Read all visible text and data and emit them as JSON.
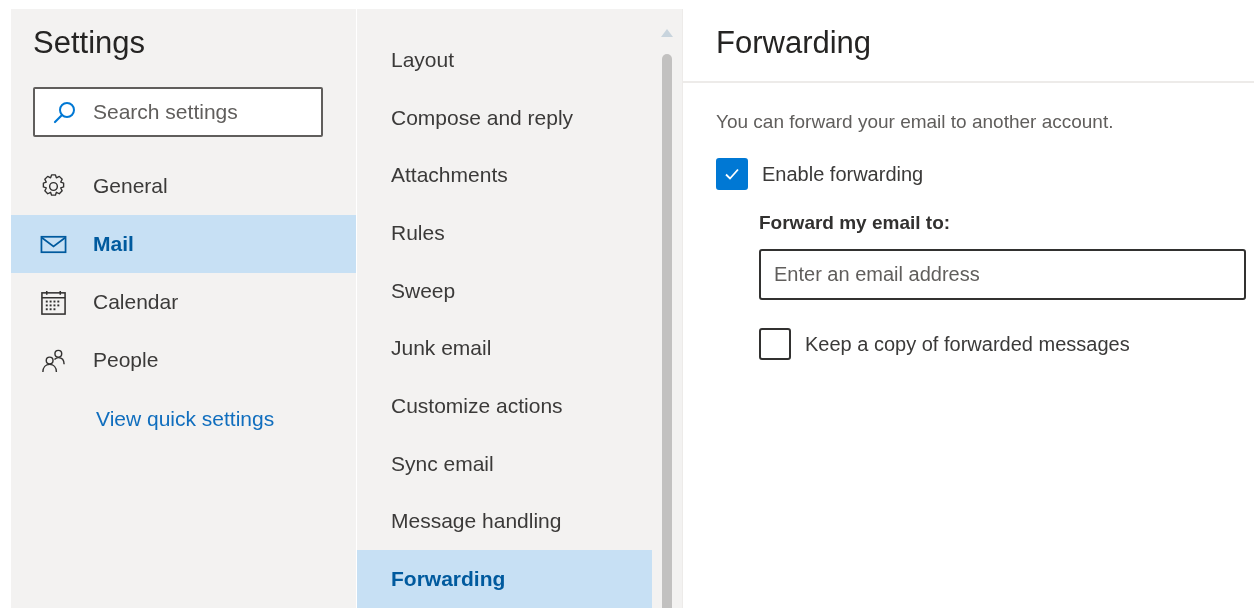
{
  "sidebar": {
    "title": "Settings",
    "search": {
      "placeholder": "Search settings"
    },
    "items": [
      {
        "label": "General",
        "kind": "gear",
        "selected": false
      },
      {
        "label": "Mail",
        "kind": "mail",
        "selected": true
      },
      {
        "label": "Calendar",
        "kind": "calendar",
        "selected": false
      },
      {
        "label": "People",
        "kind": "people",
        "selected": false
      }
    ],
    "link": "View quick settings"
  },
  "submenu": {
    "items": [
      {
        "label": "Layout",
        "selected": false
      },
      {
        "label": "Compose and reply",
        "selected": false
      },
      {
        "label": "Attachments",
        "selected": false
      },
      {
        "label": "Rules",
        "selected": false
      },
      {
        "label": "Sweep",
        "selected": false
      },
      {
        "label": "Junk email",
        "selected": false
      },
      {
        "label": "Customize actions",
        "selected": false
      },
      {
        "label": "Sync email",
        "selected": false
      },
      {
        "label": "Message handling",
        "selected": false
      },
      {
        "label": "Forwarding",
        "selected": true
      }
    ]
  },
  "content": {
    "title": "Forwarding",
    "description": "You can forward your email to another account.",
    "enable": {
      "label": "Enable forwarding",
      "checked": true
    },
    "field_label": "Forward my email to:",
    "field": {
      "placeholder": "Enter an email address"
    },
    "keep_copy": {
      "label": "Keep a copy of forwarded messages",
      "checked": false
    }
  }
}
